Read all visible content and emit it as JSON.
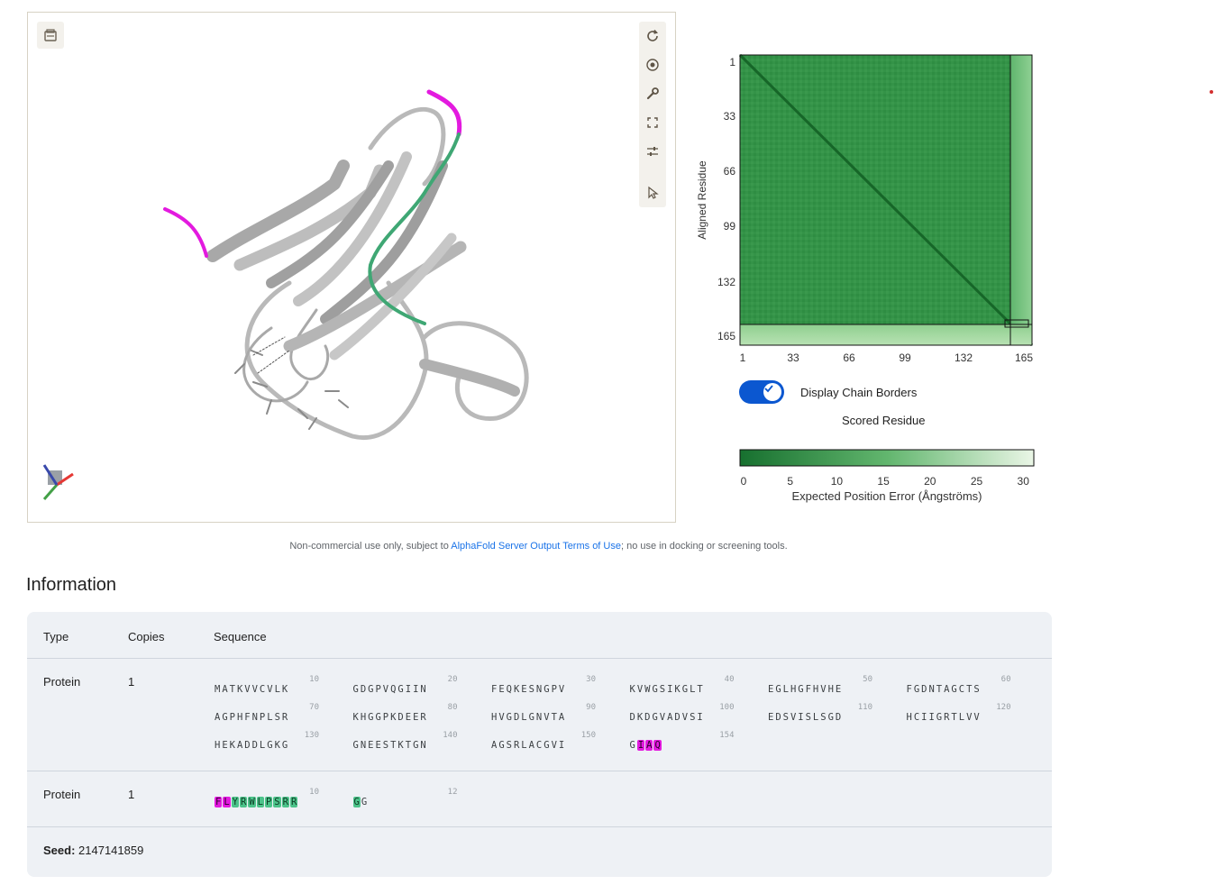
{
  "viewer": {
    "left_button_icon": "screenshot-icon",
    "tools": [
      "reset-view-icon",
      "center-icon",
      "wrench-icon",
      "fullscreen-icon",
      "settings-sliders-icon",
      "select-pointer-icon"
    ]
  },
  "pae": {
    "y_axis_label": "Aligned Residue",
    "y_ticks": [
      "1",
      "33",
      "66",
      "99",
      "132",
      "165"
    ],
    "x_ticks": [
      "1",
      "33",
      "66",
      "99",
      "132",
      "165"
    ],
    "toggle_label": "Display Chain Borders",
    "toggle_on": true,
    "x_axis_label": "Scored Residue",
    "colorbar_ticks": [
      "0",
      "5",
      "10",
      "15",
      "20",
      "25",
      "30"
    ],
    "colorbar_label": "Expected Position Error (Ångströms)",
    "colors": {
      "dark": "#1e7a34",
      "mid": "#3f9f52",
      "light": "#e8f5e4"
    }
  },
  "note": {
    "prefix": "Non-commercial use only, subject to ",
    "link": "AlphaFold Server Output Terms of Use",
    "suffix": "; no use in docking or screening tools."
  },
  "info": {
    "title": "Information",
    "headers": {
      "type": "Type",
      "copies": "Copies",
      "sequence": "Sequence"
    },
    "rows": [
      {
        "type": "Protein",
        "copies": "1",
        "blocks": [
          {
            "num": "10",
            "res": "MATKVVCVLK"
          },
          {
            "num": "20",
            "res": "GDGPVQGIIN"
          },
          {
            "num": "30",
            "res": "FEQKESNGPV"
          },
          {
            "num": "40",
            "res": "KVWGSIKGLT"
          },
          {
            "num": "50",
            "res": "EGLHGFHVHE"
          },
          {
            "num": "60",
            "res": "FGDNTAGCTS"
          },
          {
            "num": "70",
            "res": "AGPHFNPLSR"
          },
          {
            "num": "80",
            "res": "KHGGPKDEER"
          },
          {
            "num": "90",
            "res": "HVGDLGNVTA"
          },
          {
            "num": "100",
            "res": "DKDGVADVSI"
          },
          {
            "num": "110",
            "res": "EDSVISLSGD"
          },
          {
            "num": "120",
            "res": "HCIIGRTLVV"
          },
          {
            "num": "130",
            "res": "HEKADDLGKG"
          },
          {
            "num": "140",
            "res": "GNEESTKTGN"
          },
          {
            "num": "150",
            "res": "AGSRLACGVI"
          },
          {
            "num": "154",
            "res": "GIAQ"
          }
        ]
      },
      {
        "type": "Protein",
        "copies": "1",
        "blocks": [
          {
            "num": "10",
            "res": "FLYRWLPSRR"
          },
          {
            "num": "12",
            "res": "GG"
          }
        ]
      }
    ],
    "seed_label": "Seed:",
    "seed_value": "2147141859"
  }
}
